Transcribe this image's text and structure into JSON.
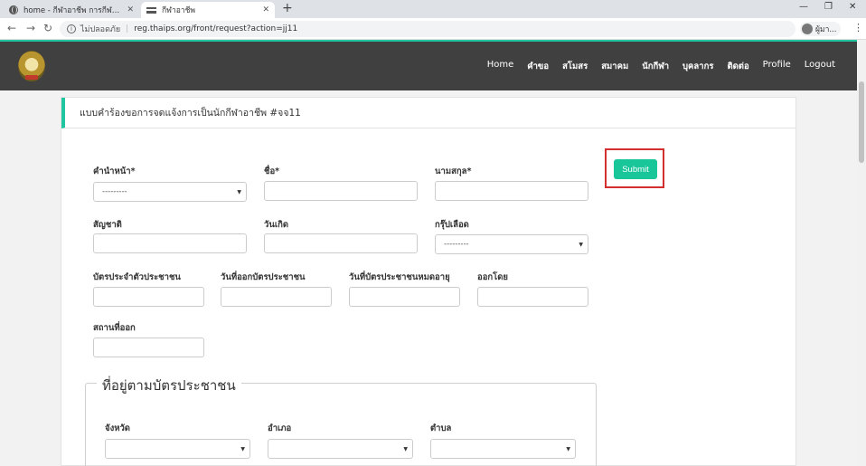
{
  "browser": {
    "tabs": [
      {
        "title": "home - กีฬาอาชีพ การกีฬาแห่งประเท",
        "active": false,
        "icon": "globe-icon"
      },
      {
        "title": "กีฬาอาชีพ",
        "active": true,
        "icon": "site-favicon"
      }
    ],
    "new_tab": "+",
    "window_controls": {
      "minimize": "—",
      "restore": "❐",
      "close": "✕"
    },
    "nav": {
      "back": "←",
      "forward": "→",
      "reload": "↻"
    },
    "security_label": "ไม่ปลอดภัย",
    "url": "reg.thaips.org/front/request?action=jj11",
    "profile_label": "ผู้มา...",
    "menu": "⋮"
  },
  "site_nav": {
    "items": [
      {
        "label": "Home"
      },
      {
        "label": "คำขอ"
      },
      {
        "label": "สโมสร"
      },
      {
        "label": "สมาคม"
      },
      {
        "label": "นักกีฬา"
      },
      {
        "label": "บุคลากร"
      },
      {
        "label": "ติดต่อ"
      },
      {
        "label": "Profile"
      },
      {
        "label": "Logout"
      }
    ]
  },
  "form": {
    "header": "แบบคำร้องขอการจดแจ้งการเป็นนักกีฬาอาชีพ #จจ11",
    "submit_label": "Submit",
    "fields": {
      "title": {
        "label": "คำนำหน้า*",
        "value": "---------"
      },
      "first_name": {
        "label": "ชื่อ*"
      },
      "last_name": {
        "label": "นามสกุล*"
      },
      "nationality": {
        "label": "สัญชาติ"
      },
      "birth_date": {
        "label": "วันเกิด"
      },
      "blood_group": {
        "label": "กรุ๊ปเลือด",
        "value": "---------"
      },
      "id_card": {
        "label": "บัตรประจำตัวประชาชน"
      },
      "id_issue_date": {
        "label": "วันที่ออกบัตรประชาชน"
      },
      "id_expiry_date": {
        "label": "วันที่บัตรประชาชนหมดอายุ"
      },
      "issued_by": {
        "label": "ออกโดย"
      },
      "issue_place": {
        "label": "สถานที่ออก"
      }
    },
    "address": {
      "legend": "ที่อยู่ตามบัตรประชาชน",
      "province": {
        "label": "จังหวัด"
      },
      "district": {
        "label": "อำเภอ"
      },
      "subdistrict": {
        "label": "ตำบล"
      }
    }
  }
}
